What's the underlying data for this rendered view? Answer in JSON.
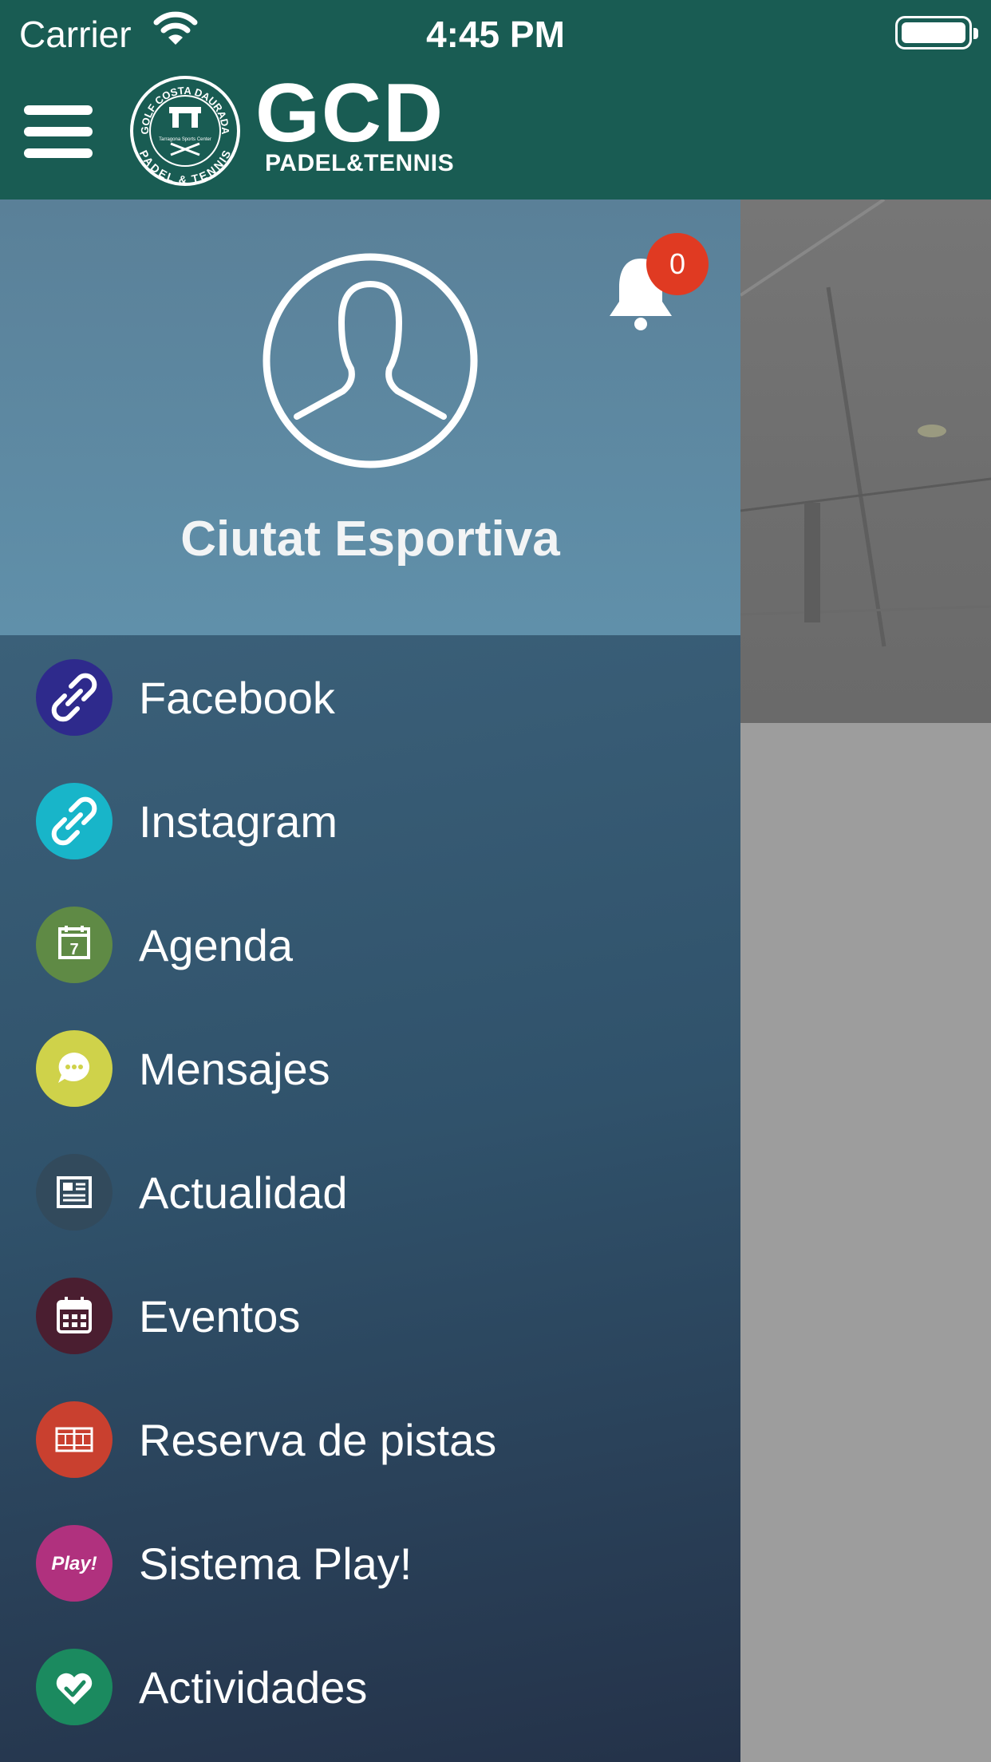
{
  "status_bar": {
    "carrier": "Carrier",
    "time": "4:45 PM"
  },
  "header": {
    "logo_main": "GCD",
    "logo_sub": "PADEL&TENNIS",
    "seal_top": "GOLF COSTA DAURADA",
    "seal_bottom": "PADEL & TENNIS",
    "seal_inner": "Tarragona Sports Center"
  },
  "profile": {
    "name": "Ciutat Esportiva",
    "notification_count": "0"
  },
  "menu": {
    "items": [
      {
        "label": "Facebook",
        "icon": "link-icon",
        "color": "#2e2a8c"
      },
      {
        "label": "Instagram",
        "icon": "link-icon",
        "color": "#18b5c9"
      },
      {
        "label": "Agenda",
        "icon": "calendar-7-icon",
        "color": "#5f8a45",
        "icon_text": "7"
      },
      {
        "label": "Mensajes",
        "icon": "chat-bubble-icon",
        "color": "#cfd24a"
      },
      {
        "label": "Actualidad",
        "icon": "newspaper-icon",
        "color": "#324a5c"
      },
      {
        "label": "Eventos",
        "icon": "calendar-grid-icon",
        "color": "#4a1e30"
      },
      {
        "label": "Reserva de pistas",
        "icon": "court-icon",
        "color": "#c9402f"
      },
      {
        "label": "Sistema Play!",
        "icon": "play-text-icon",
        "color": "#b0317e",
        "icon_text": "Play!"
      },
      {
        "label": "Actividades",
        "icon": "heart-check-icon",
        "color": "#1b8a5f"
      }
    ]
  }
}
